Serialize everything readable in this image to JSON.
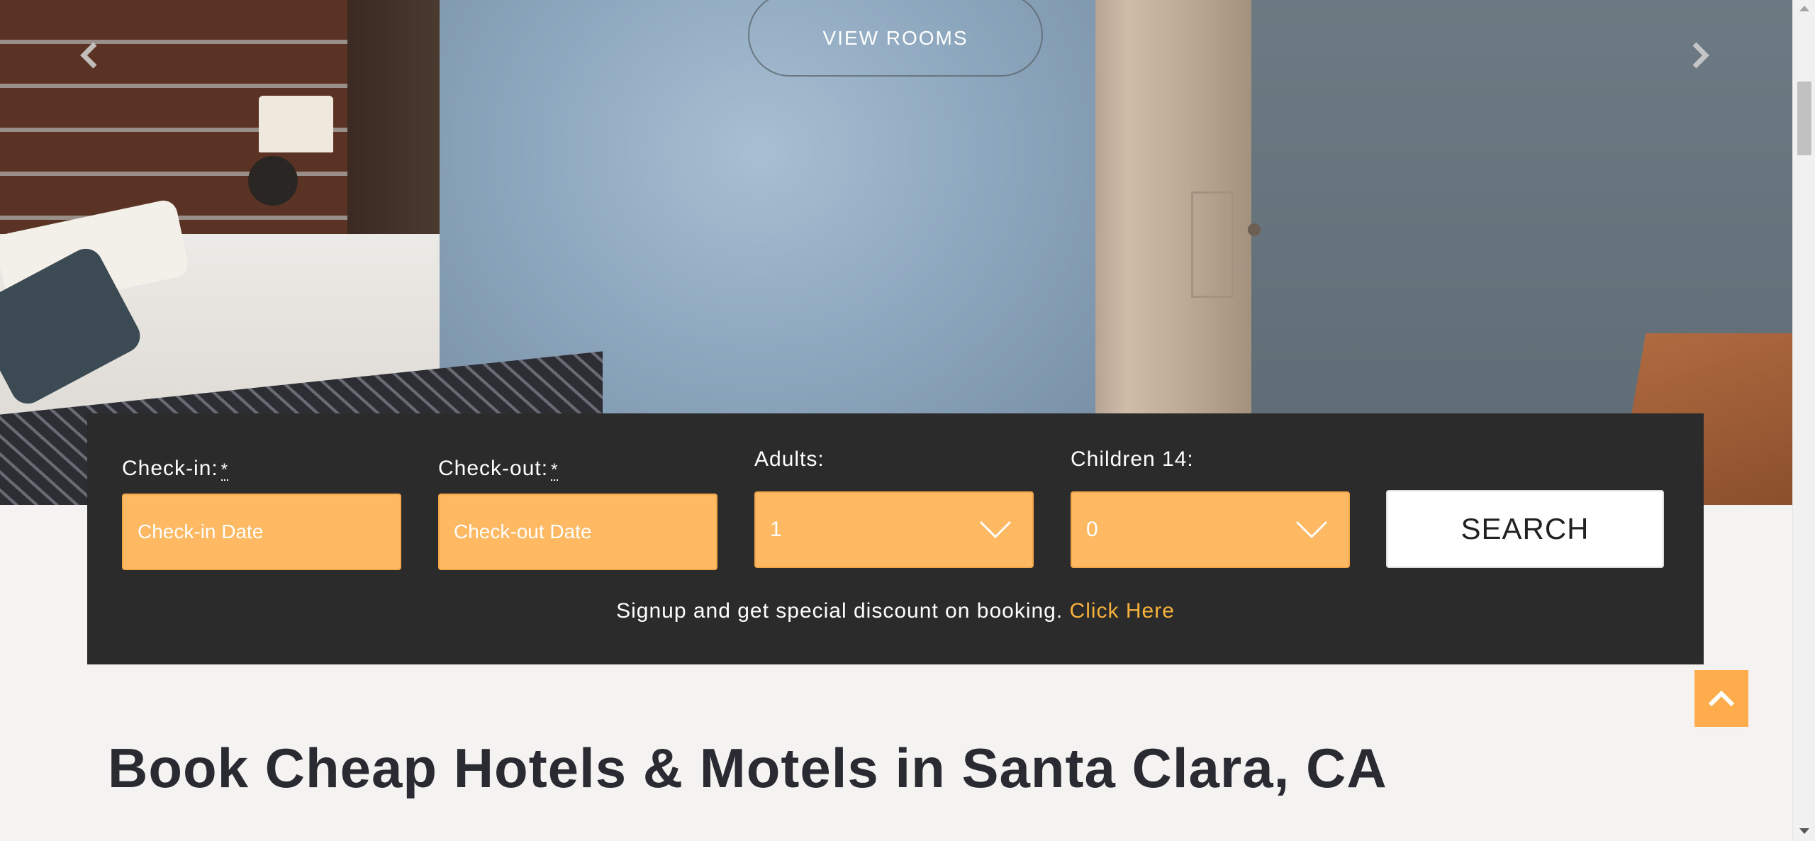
{
  "hero": {
    "view_rooms_label": "VIEW ROOMS",
    "prev_icon": "chevron-left-icon",
    "next_icon": "chevron-right-icon"
  },
  "booking": {
    "checkin_label": "Check-in:",
    "checkout_label": "Check-out:",
    "required_mark": "*",
    "adults_label": "Adults:",
    "children_label": "Children 14:",
    "checkin_placeholder": "Check-in Date",
    "checkout_placeholder": "Check-out Date",
    "adults_value": "1",
    "children_value": "0",
    "search_label": "SEARCH",
    "signup_text": "Signup and get special discount on booking.",
    "signup_link": "Click Here"
  },
  "main": {
    "heading": "Book Cheap Hotels & Motels in Santa Clara, CA"
  },
  "colors": {
    "accent_orange": "#ffb963",
    "link_gold": "#f6b23a",
    "panel_dark": "#2b2b2b",
    "to_top_orange": "#ffad4c"
  },
  "icons": {
    "select_arrow": "chevron-down-icon",
    "back_to_top": "chevron-up-icon"
  }
}
